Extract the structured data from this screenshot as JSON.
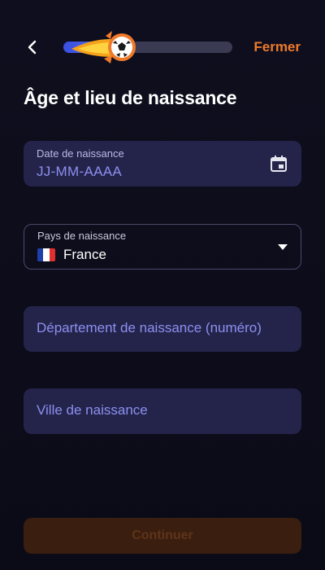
{
  "header": {
    "close_label": "Fermer",
    "progress": 0.4
  },
  "title": "Âge et lieu de naissance",
  "fields": {
    "birth_date": {
      "label": "Date de naissance",
      "value": "JJ-MM-AAAA"
    },
    "birth_country": {
      "label": "Pays de naissance",
      "value": "France"
    },
    "birth_department": {
      "placeholder": "Département de naissance (numéro)"
    },
    "birth_city": {
      "placeholder": "Ville de naissance"
    }
  },
  "continue_label": "Continuer",
  "colors": {
    "accent": "#f07a2a",
    "field_bg": "#24244a",
    "progress": "#4a64ee"
  }
}
